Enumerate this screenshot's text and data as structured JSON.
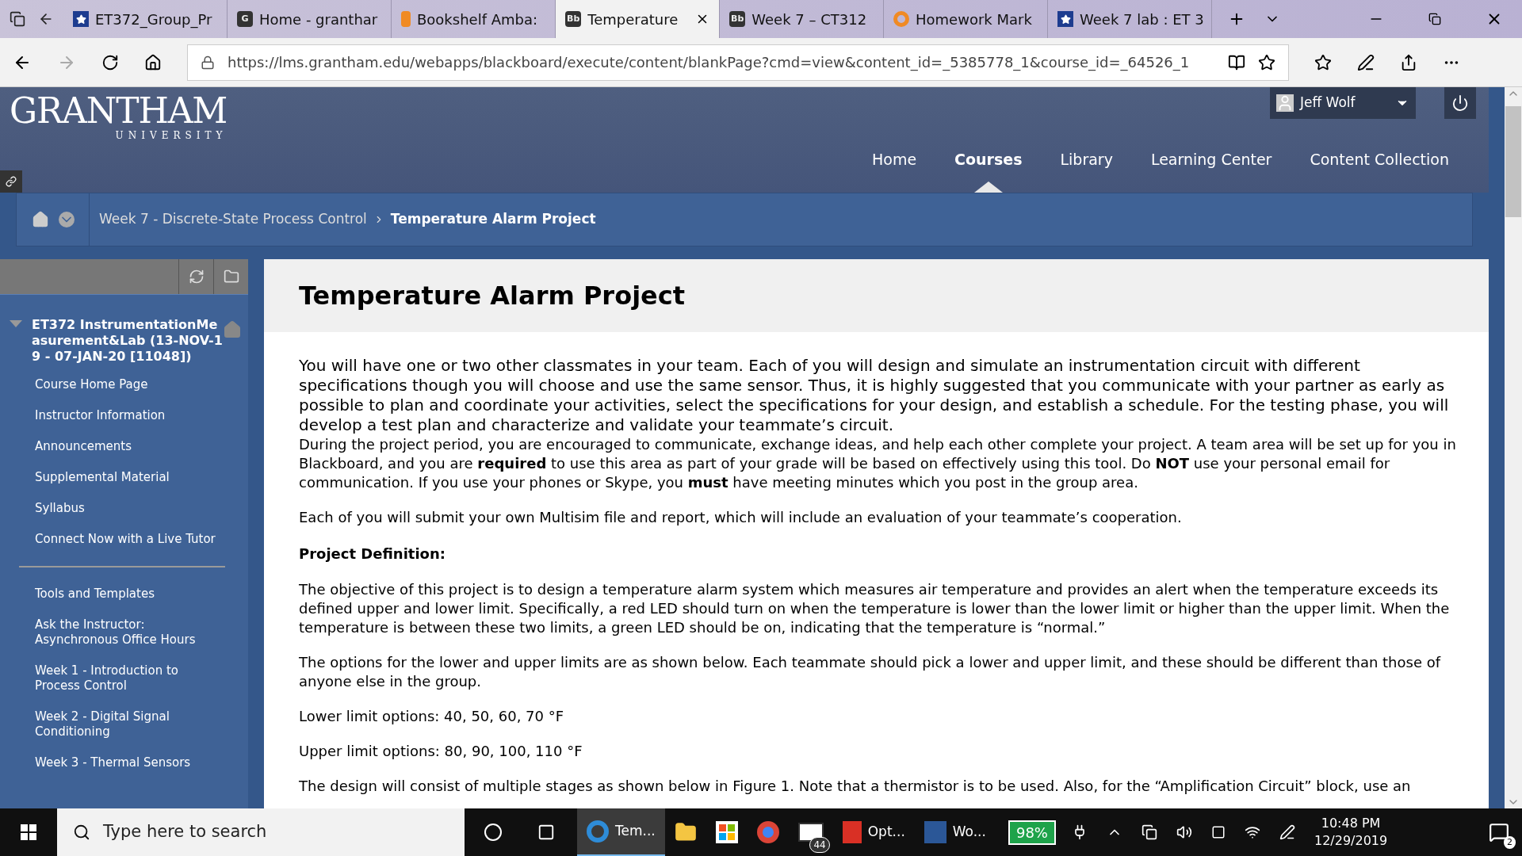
{
  "browser": {
    "tabs": [
      {
        "title": "ET372_Group_Pr",
        "selected": false,
        "icon": {
          "kind": "star"
        }
      },
      {
        "title": "Home - granthar",
        "selected": false,
        "icon": {
          "kind": "letter",
          "text": "G"
        }
      },
      {
        "title": "Bookshelf Amba:",
        "selected": false,
        "icon": {
          "kind": "book"
        }
      },
      {
        "title": "Temperature",
        "selected": true,
        "icon": {
          "kind": "letter",
          "text": "Bb"
        }
      },
      {
        "title": "Week 7 – CT312",
        "selected": false,
        "icon": {
          "kind": "letter",
          "text": "Bb"
        }
      },
      {
        "title": "Homework Mark",
        "selected": false,
        "icon": {
          "kind": "ring"
        }
      },
      {
        "title": "Week 7 lab : ET 3",
        "selected": false,
        "icon": {
          "kind": "star"
        }
      }
    ],
    "url": "https://lms.grantham.edu/webapps/blackboard/execute/content/blankPage?cmd=view&content_id=_5385778_1&course_id=_64526_1"
  },
  "header": {
    "logo": {
      "name": "GRANTHAM",
      "sub": "UNIVERSITY"
    },
    "user": "Jeff Wolf",
    "nav": [
      {
        "label": "Home",
        "selected": false
      },
      {
        "label": "Courses",
        "selected": true
      },
      {
        "label": "Library",
        "selected": false
      },
      {
        "label": "Learning Center",
        "selected": false
      },
      {
        "label": "Content Collection",
        "selected": false
      }
    ]
  },
  "breadcrumb": [
    "Week 7 - Discrete-State Process Control",
    "Temperature Alarm Project"
  ],
  "sidebar": {
    "course": "ET372 InstrumentationMeasurement&Lab (13-NOV-19 - 07-JAN-20 [11048])",
    "expanded": true,
    "groups": [
      [
        "Course Home Page",
        "Instructor Information",
        "Announcements",
        "Supplemental Material",
        "Syllabus",
        "Connect Now with a Live Tutor"
      ],
      [
        "Tools and Templates",
        "Ask the Instructor: Asynchronous Office Hours",
        "Week 1 - Introduction to Process Control",
        "Week 2 - Digital Signal Conditioning",
        "Week 3 - Thermal Sensors"
      ]
    ]
  },
  "content": {
    "title": "Temperature Alarm Project",
    "blocks": [
      {
        "kind": "lead",
        "text": "You will have one or two other classmates in your team. Each of you will design and simulate an instrumentation circuit with different specifications though you will choose and use the same sensor. Thus, it is highly suggested that you communicate with your partner as early as possible to plan and coordinate your activities, select the specifications for your design, and establish a schedule. For the testing phase, you will develop a test plan and characterize and validate your teammate’s circuit."
      },
      {
        "kind": "tight",
        "text": "During the project period, you are encouraged to communicate, exchange ideas, and help each other complete your project. A team area will be set up for you in Blackboard, and you are **required** to use this area as part of your grade will be based on effectively using this tool.  Do **NOT** use your personal email for communication.  If you use your phones or Skype, you **must** have meeting minutes which you post in the group area."
      },
      {
        "kind": "para",
        "text": "Each of you will submit your own Multisim file and report, which will include an evaluation of your teammate’s cooperation."
      },
      {
        "kind": "heading",
        "text": "Project Definition:"
      },
      {
        "kind": "para",
        "text": "The objective of this project is to design a temperature alarm system which measures air temperature and provides an alert when the temperature exceeds its defined upper and lower limit. Specifically, a red LED should turn on when the temperature is lower than the lower limit or higher than the upper limit. When the temperature is between these two limits, a green LED should be on, indicating that the temperature is “normal.”"
      },
      {
        "kind": "para",
        "text": "The options for the lower and upper limits are as shown below. Each teammate should pick a lower and upper limit, and these should be different than those of anyone else in the group."
      },
      {
        "kind": "para",
        "text": "Lower limit options: 40, 50, 60, 70 °F"
      },
      {
        "kind": "para",
        "text": "Upper limit options: 80, 90, 100, 110 °F"
      },
      {
        "kind": "para",
        "text": "The design will consist of multiple stages as shown below in Figure 1. Note that a thermistor is to be used. Also, for the “Amplification Circuit” block, use an"
      }
    ]
  },
  "taskbar": {
    "search": "Type here to search",
    "apps": [
      {
        "kind": "edge",
        "label": "Tem...",
        "active": true
      },
      {
        "kind": "folder",
        "active": false
      },
      {
        "kind": "store",
        "active": false
      },
      {
        "kind": "chrome",
        "active": false
      },
      {
        "kind": "mail",
        "badge": "44",
        "active": false
      },
      {
        "kind": "pdf",
        "label": "Opt...",
        "active": false
      },
      {
        "kind": "word",
        "label": "Wo...",
        "active": false
      }
    ],
    "battery": "98%",
    "time": "10:48 PM",
    "date": "12/29/2019",
    "notifications": "2"
  }
}
